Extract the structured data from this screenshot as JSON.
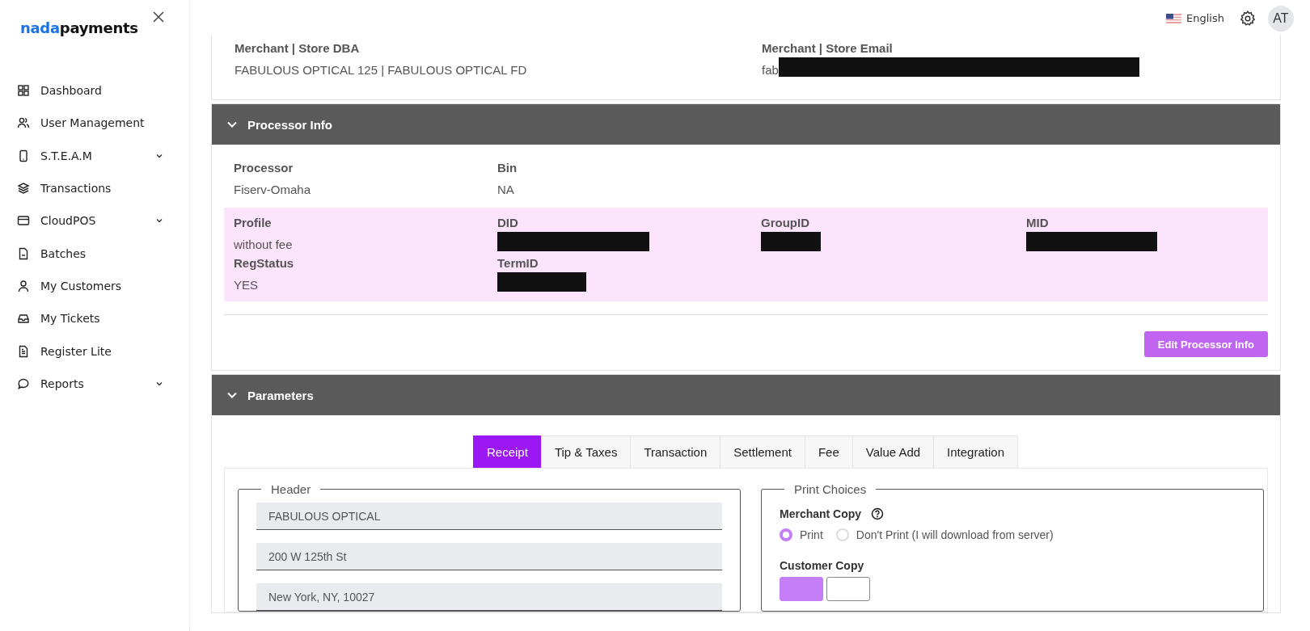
{
  "sidebar": {
    "logo": {
      "first": "nada",
      "second": "payments"
    },
    "items": [
      {
        "label": "Dashboard",
        "has_submenu": false
      },
      {
        "label": "User Management",
        "has_submenu": false
      },
      {
        "label": "S.T.E.A.M",
        "has_submenu": true
      },
      {
        "label": "Transactions",
        "has_submenu": false
      },
      {
        "label": "CloudPOS",
        "has_submenu": true
      },
      {
        "label": "Batches",
        "has_submenu": false
      },
      {
        "label": "My Customers",
        "has_submenu": false
      },
      {
        "label": "My Tickets",
        "has_submenu": false
      },
      {
        "label": "Register Lite",
        "has_submenu": false
      },
      {
        "label": "Reports",
        "has_submenu": true
      }
    ]
  },
  "topbar": {
    "language": "English",
    "avatar": "AT"
  },
  "merchant": {
    "fields": [
      {
        "label": "Merchant | Store DBA",
        "value": "FABULOUS OPTICAL 125 | FABULOUS OPTICAL FD",
        "redacted": false
      },
      {
        "label": "Merchant | Store Email",
        "value": "fab",
        "redacted": true
      }
    ]
  },
  "processor": {
    "title": "Processor Info",
    "expanded": true,
    "fields": [
      {
        "label": "Processor",
        "value": "Fiserv-Omaha",
        "redacted": false
      },
      {
        "label": "Bin",
        "value": "NA",
        "redacted": false
      }
    ],
    "profile_fields": [
      {
        "label": "Profile",
        "value": "without fee",
        "redacted": false
      },
      {
        "label": "DID",
        "redacted": true
      },
      {
        "label": "GroupID",
        "redacted": true
      },
      {
        "label": "MID",
        "redacted": true
      },
      {
        "label": "RegStatus",
        "value": "YES",
        "redacted": false
      },
      {
        "label": "TermID",
        "redacted": true
      }
    ],
    "button": "Edit Processor Info"
  },
  "parameters": {
    "title": "Parameters",
    "expanded": true,
    "tabs": [
      {
        "label": "Receipt",
        "selected": true
      },
      {
        "label": "Tip & Taxes",
        "selected": false
      },
      {
        "label": "Transaction",
        "selected": false
      },
      {
        "label": "Settlement",
        "selected": false
      },
      {
        "label": "Fee",
        "selected": false
      },
      {
        "label": "Value Add",
        "selected": false
      },
      {
        "label": "Integration",
        "selected": false
      }
    ],
    "header": {
      "legend": "Header",
      "lines": [
        "FABULOUS OPTICAL",
        "200 W 125th St",
        "New York, NY, 10027"
      ]
    },
    "print_choices": {
      "legend": "Print Choices",
      "merchant_copy": {
        "label": "Merchant Copy",
        "options": [
          {
            "label": "Print",
            "selected": true
          },
          {
            "label": "Don't Print (I will download from server)",
            "selected": false
          }
        ]
      },
      "customer_copy": {
        "label": "Customer Copy",
        "options": [
          {
            "selected": true
          },
          {
            "selected": false
          }
        ]
      }
    }
  }
}
